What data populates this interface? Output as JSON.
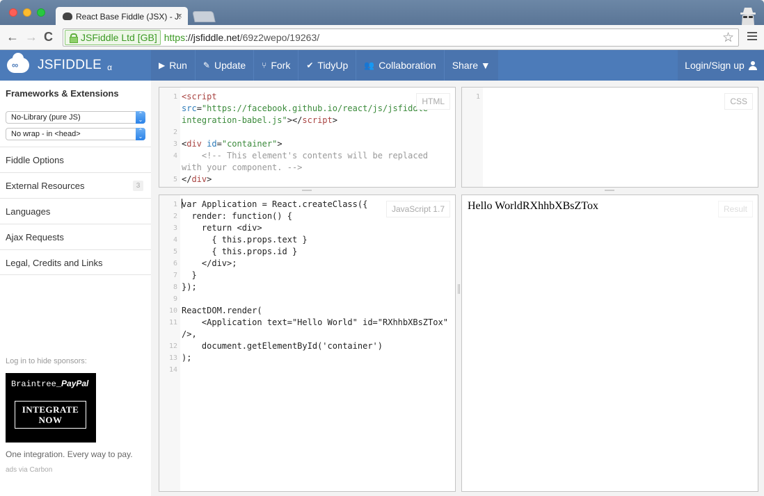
{
  "browser": {
    "tab_title": "React Base Fiddle (JSX) - JSFiddle",
    "tab_close": "×",
    "ev_cert": "JSFiddle Ltd [GB]",
    "url_scheme": "https",
    "url_host": "://jsfiddle.net",
    "url_path": "/69z2wepo/19263/",
    "back": "←",
    "forward": "→",
    "reload": "C",
    "bookmark_star": "☆"
  },
  "header": {
    "brand": "JSFIDDLE",
    "brand_suffix": "α",
    "logo_glyph": "∞",
    "actions": [
      {
        "label": "Run",
        "icon": "▶"
      },
      {
        "label": "Update",
        "icon": "✎"
      },
      {
        "label": "Fork",
        "icon": "⑂"
      },
      {
        "label": "TidyUp",
        "icon": "✔"
      },
      {
        "label": "Collaboration",
        "icon": "👥"
      },
      {
        "label": "Share ▼",
        "icon": ""
      }
    ],
    "login": "Login/Sign up"
  },
  "sidebar": {
    "title": "Frameworks & Extensions",
    "library_select": "No-Library (pure JS)",
    "wrap_select": "No wrap - in <head>",
    "caret": "⌃⌄",
    "items": [
      {
        "label": "Fiddle Options",
        "badge": null
      },
      {
        "label": "External Resources",
        "badge": "3"
      },
      {
        "label": "Languages",
        "badge": null
      },
      {
        "label": "Ajax Requests",
        "badge": null
      },
      {
        "label": "Legal, Credits and Links",
        "badge": null
      }
    ],
    "sponsor_note": "Log in to hide sponsors:",
    "ad": {
      "brand_left": "Braintree_",
      "brand_right": "PayPal",
      "cta_line1": "INTEGRATE",
      "cta_line2": "NOW",
      "tagline": "One integration. Every way to pay.",
      "via": "ads via Carbon"
    }
  },
  "panels": {
    "html": {
      "label": "HTML",
      "lines": [
        {
          "n": "1",
          "segments": [
            {
              "t": "<script",
              "c": "tag"
            },
            {
              "t": "\nsrc",
              "c": "attr"
            },
            {
              "t": "=",
              "c": ""
            },
            {
              "t": "\"https://facebook.github.io/react/js/jsfiddle-integration-babel.js\"",
              "c": "str"
            },
            {
              "t": "></",
              "c": ""
            },
            {
              "t": "script",
              "c": "tag"
            },
            {
              "t": ">",
              "c": ""
            }
          ]
        },
        {
          "n": "2",
          "segments": []
        },
        {
          "n": "3",
          "segments": [
            {
              "t": "<",
              "c": ""
            },
            {
              "t": "div",
              "c": "tag"
            },
            {
              "t": " id",
              "c": "attr"
            },
            {
              "t": "=",
              "c": ""
            },
            {
              "t": "\"container\"",
              "c": "str"
            },
            {
              "t": ">",
              "c": ""
            }
          ]
        },
        {
          "n": "4",
          "segments": [
            {
              "t": "    <!-- This element's contents will be replaced with your component. -->",
              "c": "cmt"
            }
          ]
        },
        {
          "n": "5",
          "segments": [
            {
              "t": "</",
              "c": ""
            },
            {
              "t": "div",
              "c": "tag"
            },
            {
              "t": ">",
              "c": ""
            }
          ]
        }
      ]
    },
    "css": {
      "label": "CSS",
      "lines": [
        {
          "n": "1",
          "segments": []
        }
      ]
    },
    "js": {
      "label": "JavaScript 1.7",
      "lines": [
        {
          "n": "1",
          "segments": [
            {
              "t": "var Application = React.createClass({",
              "c": ""
            }
          ]
        },
        {
          "n": "2",
          "segments": [
            {
              "t": "  render: function() {",
              "c": ""
            }
          ]
        },
        {
          "n": "3",
          "segments": [
            {
              "t": "    return <div>",
              "c": ""
            }
          ]
        },
        {
          "n": "4",
          "segments": [
            {
              "t": "      { this.props.text }",
              "c": ""
            }
          ]
        },
        {
          "n": "5",
          "segments": [
            {
              "t": "      { this.props.id }",
              "c": ""
            }
          ]
        },
        {
          "n": "6",
          "segments": [
            {
              "t": "    </div>;",
              "c": ""
            }
          ]
        },
        {
          "n": "7",
          "segments": [
            {
              "t": "  }",
              "c": ""
            }
          ]
        },
        {
          "n": "8",
          "segments": [
            {
              "t": "});",
              "c": ""
            }
          ]
        },
        {
          "n": "9",
          "segments": []
        },
        {
          "n": "10",
          "segments": [
            {
              "t": "ReactDOM.render(",
              "c": ""
            }
          ]
        },
        {
          "n": "11",
          "segments": [
            {
              "t": "    <Application text=\"Hello World\" id=\"RXhhbXBsZTox\" />,",
              "c": ""
            }
          ]
        },
        {
          "n": "12",
          "segments": [
            {
              "t": "    document.getElementById('container')",
              "c": ""
            }
          ]
        },
        {
          "n": "13",
          "segments": [
            {
              "t": ");",
              "c": ""
            }
          ]
        },
        {
          "n": "14",
          "segments": []
        }
      ]
    },
    "result": {
      "label": "Result",
      "output": "Hello WorldRXhhbXBsZTox"
    }
  }
}
